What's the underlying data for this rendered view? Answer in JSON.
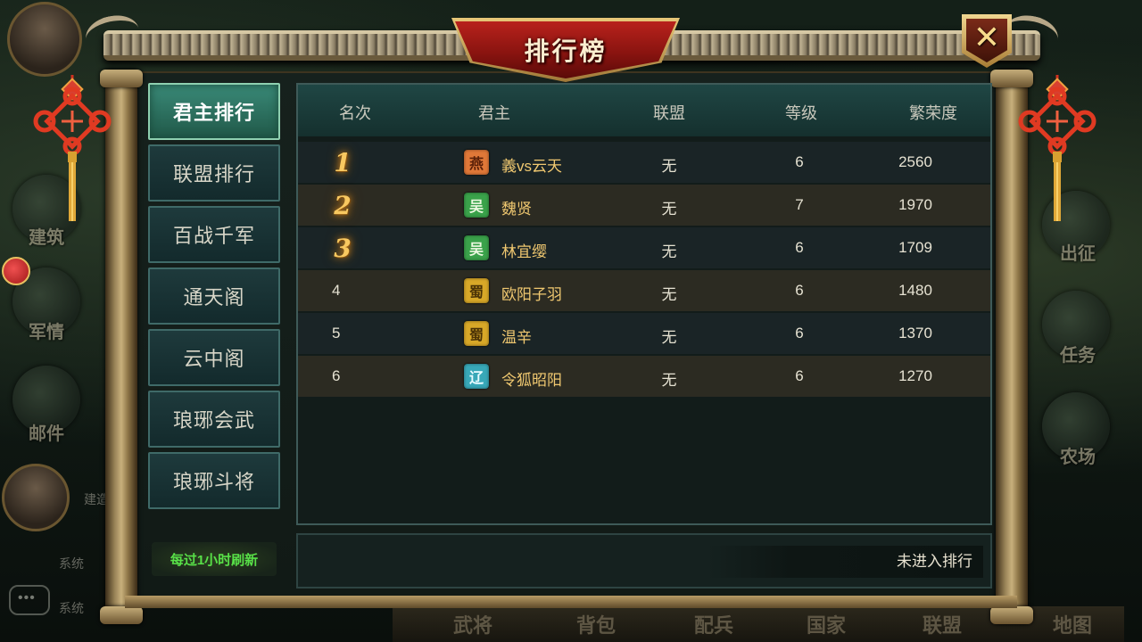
{
  "window": {
    "title": "排行榜",
    "close_icon": "close-icon"
  },
  "tabs": [
    {
      "label": "君主排行",
      "active": true
    },
    {
      "label": "联盟排行",
      "active": false
    },
    {
      "label": "百战千军",
      "active": false
    },
    {
      "label": "通天阁",
      "active": false
    },
    {
      "label": "云中阁",
      "active": false
    },
    {
      "label": "琅琊会武",
      "active": false
    },
    {
      "label": "琅琊斗将",
      "active": false
    }
  ],
  "refresh_note": "每过1小时刷新",
  "table": {
    "headers": [
      "名次",
      "君主",
      "联盟",
      "等级",
      "繁荣度"
    ],
    "rows": [
      {
        "rank": "1",
        "kingdom": "燕",
        "kingdom_color": "#e07838",
        "name": "義vs云天",
        "alliance": "无",
        "level": "6",
        "prosperity": "2560"
      },
      {
        "rank": "2",
        "kingdom": "吴",
        "kingdom_color": "#3aa24a",
        "name": "魏贤",
        "alliance": "无",
        "level": "7",
        "prosperity": "1970"
      },
      {
        "rank": "3",
        "kingdom": "吴",
        "kingdom_color": "#3aa24a",
        "name": "林宜缨",
        "alliance": "无",
        "level": "6",
        "prosperity": "1709"
      },
      {
        "rank": "4",
        "kingdom": "蜀",
        "kingdom_color": "#d8a828",
        "name": "欧阳子羽",
        "alliance": "无",
        "level": "6",
        "prosperity": "1480"
      },
      {
        "rank": "5",
        "kingdom": "蜀",
        "kingdom_color": "#d8a828",
        "name": "温辛",
        "alliance": "无",
        "level": "6",
        "prosperity": "1370"
      },
      {
        "rank": "6",
        "kingdom": "辽",
        "kingdom_color": "#38a8b8",
        "name": "令狐昭阳",
        "alliance": "无",
        "level": "6",
        "prosperity": "1270"
      }
    ]
  },
  "my_status": "未进入排行",
  "background": {
    "left_buttons": [
      "建筑",
      "军情",
      "邮件"
    ],
    "right_buttons": [
      "出征",
      "任务",
      "农场"
    ],
    "bottom_bar": [
      "武将",
      "背包",
      "配兵",
      "国家",
      "联盟",
      "地图"
    ],
    "system_texts": [
      "系统",
      "系统"
    ],
    "build_label": "建造"
  }
}
